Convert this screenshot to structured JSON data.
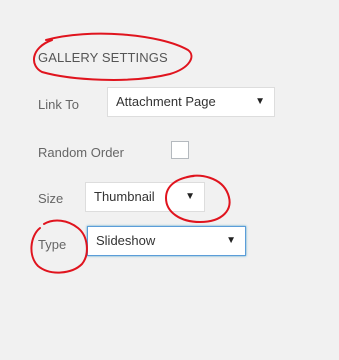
{
  "gallery_settings": {
    "heading": "GALLERY SETTINGS",
    "link_to": {
      "label": "Link To",
      "value": "Attachment Page"
    },
    "random_order": {
      "label": "Random Order",
      "checked": false
    },
    "size": {
      "label": "Size",
      "value": "Thumbnail"
    },
    "type": {
      "label": "Type",
      "value": "Slideshow"
    }
  },
  "icons": {
    "dropdown_caret": "▼"
  },
  "colors": {
    "annotation_red": "#e0141e",
    "focus_blue": "#5b9dd9"
  }
}
